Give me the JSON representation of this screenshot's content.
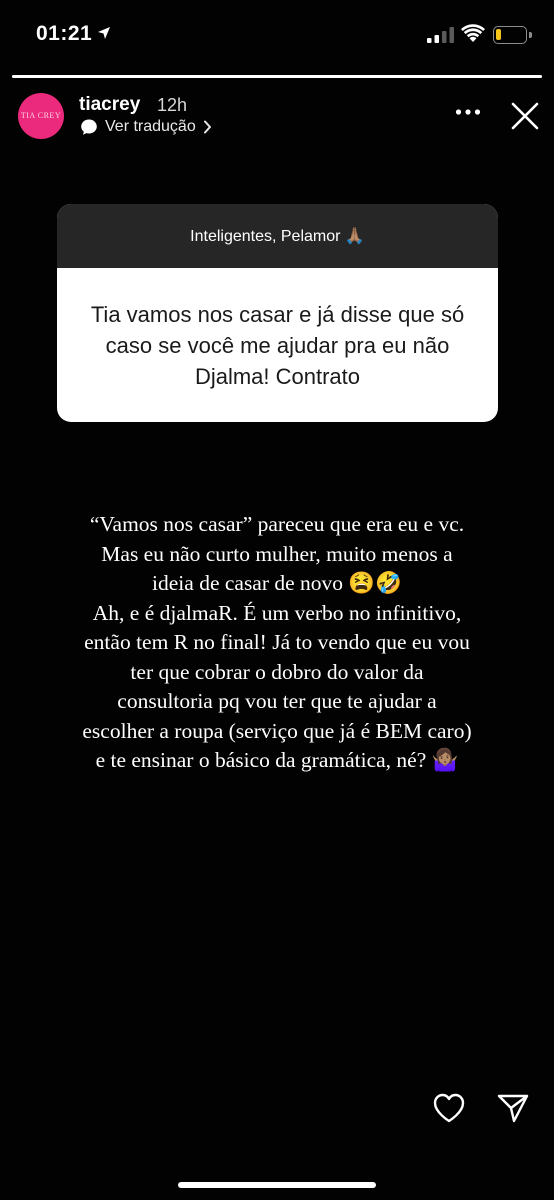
{
  "status_bar": {
    "time": "01:21",
    "battery_level": 0.2,
    "battery_color": "#f5c518"
  },
  "story": {
    "progress": 1.0,
    "username": "tiacrey",
    "time_ago": "12h",
    "translate_label": "Ver tradução",
    "avatar_text": "TIA CREY",
    "avatar_color": "#ec2a7d"
  },
  "question_card": {
    "prompt": "Inteligentes, Pelamor 🙏🏽",
    "question": "Tia vamos nos casar e já disse que só caso se você me ajudar pra eu não Djalma! Contrato"
  },
  "answer_lines": [
    "“Vamos nos casar” pareceu que era eu e vc.",
    "Mas eu não curto mulher, muito menos a",
    "ideia de casar de novo 😫🤣",
    "Ah, e é djalmaR. É um verbo no infinitivo,",
    "então tem R no final! Já to vendo que eu vou",
    "ter que cobrar o dobro do valor da",
    "consultoria pq vou ter que te ajudar a",
    "escolher a roupa (serviço que já é BEM caro)",
    "e te ensinar o básico da gramática, né? 🤷🏽‍♀️"
  ],
  "icons": {
    "location": "location-arrow-icon",
    "signal": "cellular-signal-icon",
    "wifi": "wifi-icon",
    "battery": "battery-icon",
    "more": "more-options-icon",
    "close": "close-icon",
    "translate": "speech-bubble-icon",
    "chevron": "chevron-right-icon",
    "like": "heart-icon",
    "share": "send-icon"
  }
}
